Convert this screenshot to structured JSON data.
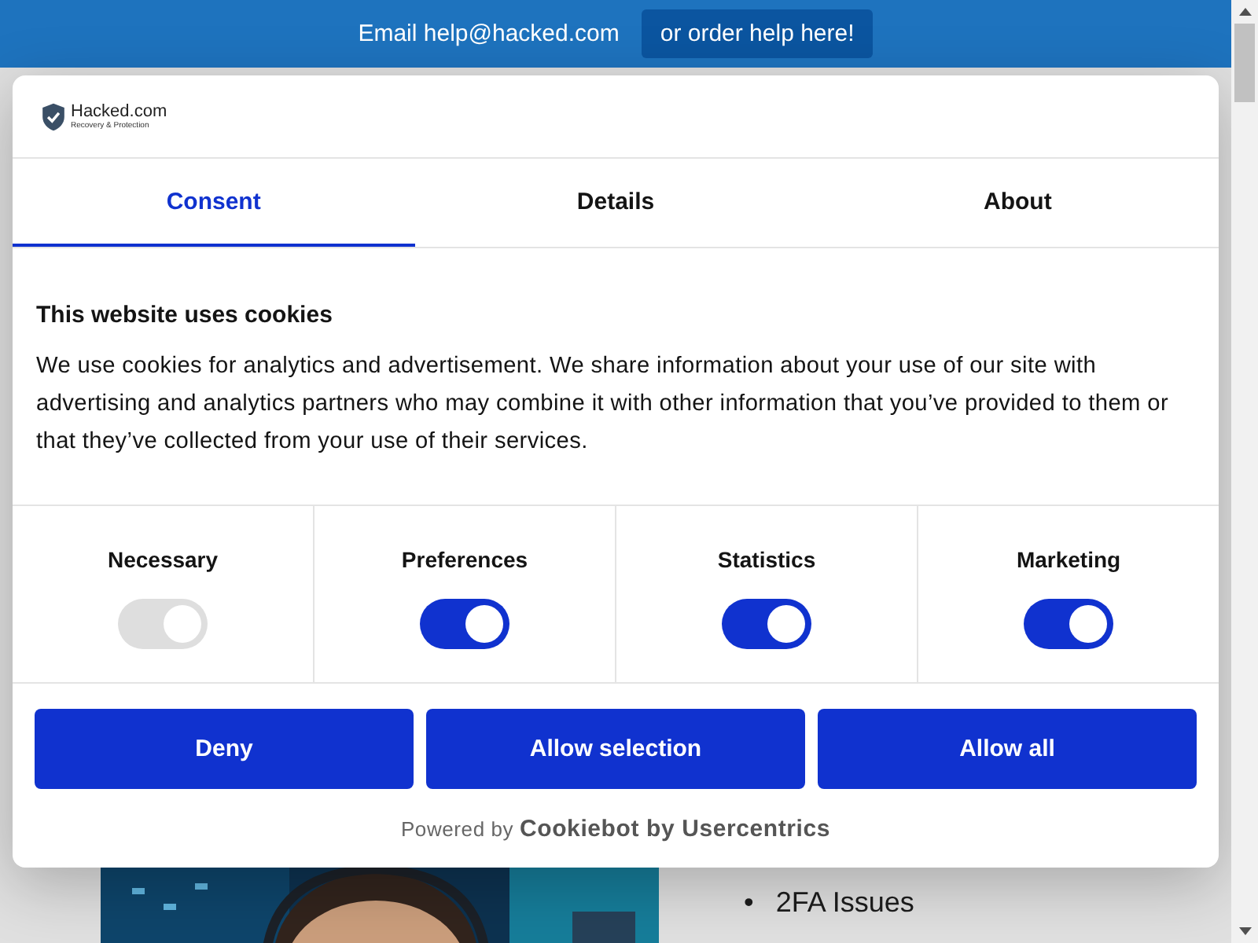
{
  "top_bar": {
    "email_text": "Email help@hacked.com",
    "order_button": "or order help here!"
  },
  "page": {
    "list_items": [
      {
        "bullet": "•",
        "text": "2FA Issues"
      }
    ]
  },
  "dialog": {
    "logo": {
      "name": "Hacked.com",
      "tagline": "Recovery & Protection"
    },
    "tabs": [
      {
        "label": "Consent",
        "selected": true
      },
      {
        "label": "Details",
        "selected": false
      },
      {
        "label": "About",
        "selected": false
      }
    ],
    "heading": "This website uses cookies",
    "text": "We use cookies for analytics and advertisement. We share information about your use of our site with advertising and analytics partners who may combine it with other information that you’ve provided to them or that they’ve collected from your use of their services.",
    "categories": [
      {
        "label": "Necessary",
        "checked": true,
        "disabled": true
      },
      {
        "label": "Preferences",
        "checked": true,
        "disabled": false
      },
      {
        "label": "Statistics",
        "checked": true,
        "disabled": false
      },
      {
        "label": "Marketing",
        "checked": true,
        "disabled": false
      }
    ],
    "buttons": [
      "Deny",
      "Allow selection",
      "Allow all"
    ],
    "footer": {
      "prefix": "Powered by",
      "brand": "Cookiebot by Usercentrics"
    }
  }
}
